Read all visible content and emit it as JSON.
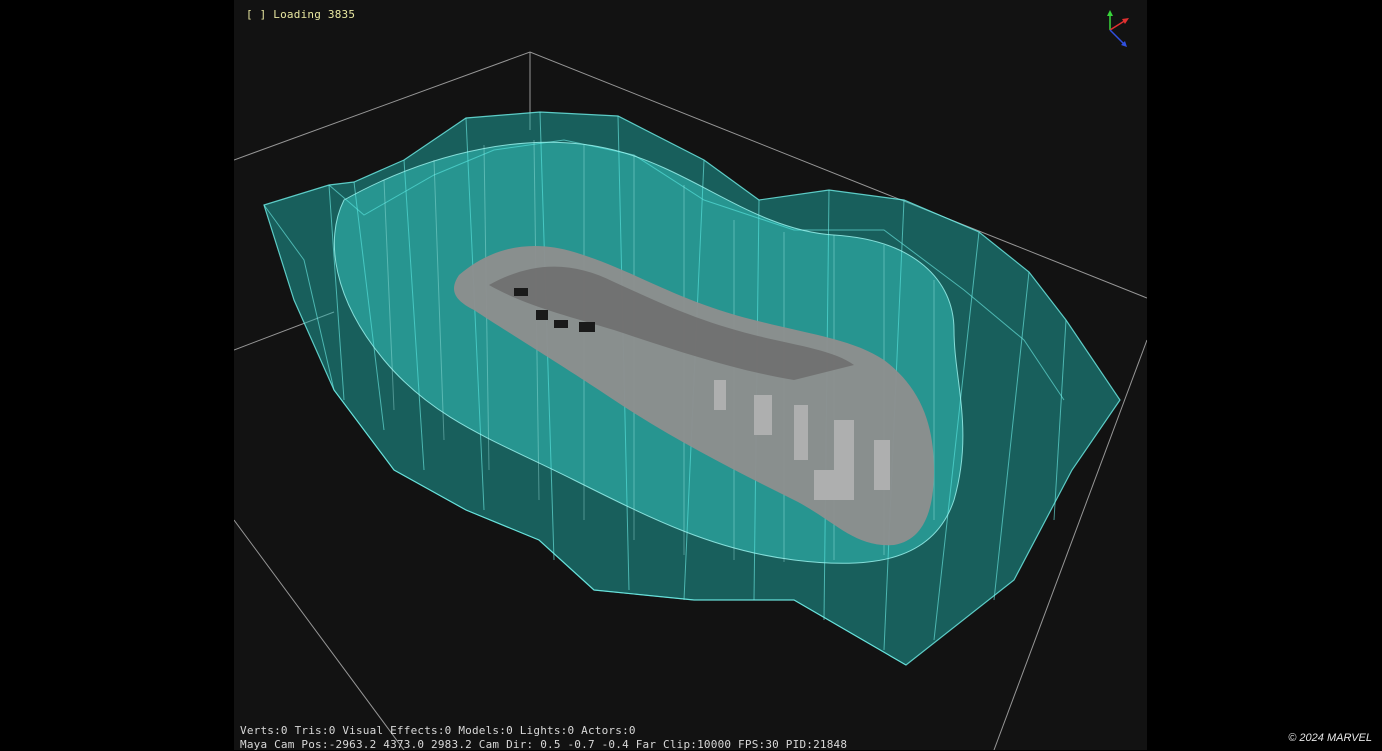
{
  "hud": {
    "loading": "[ ] Loading 3835",
    "stats": "Verts:0 Tris:0 Visual Effects:0 Models:0 Lights:0 Actors:0",
    "camera": "Maya Cam Pos:-2963.2 4373.0 2983.2 Cam Dir: 0.5 -0.7 -0.4 Far Clip:10000 FPS:30 PID:21848"
  },
  "copyright": "© 2024 MARVEL",
  "colors": {
    "volume": "#36d6cf",
    "volume_edge": "#7ff3ee",
    "ground": "#8a8a8a",
    "background": "#121212",
    "grid": "#bdbdbd"
  },
  "icons": {
    "axis_gizmo": "axis-gizmo-icon"
  }
}
